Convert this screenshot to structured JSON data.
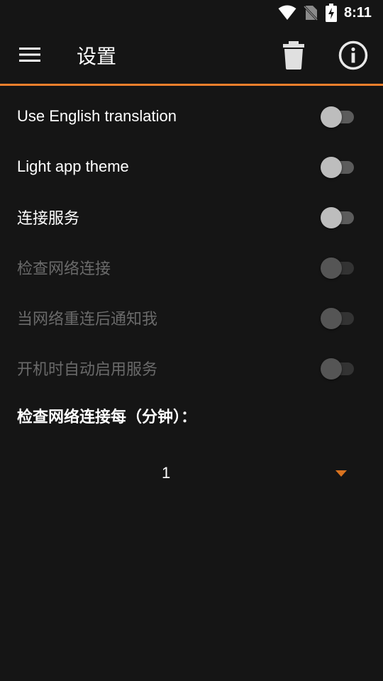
{
  "status_bar": {
    "time": "8:11",
    "icons": [
      "wifi-icon",
      "no-sim-icon",
      "battery-charging-icon"
    ]
  },
  "toolbar": {
    "title": "设置",
    "icons": [
      "menu-icon",
      "trash-icon",
      "info-icon"
    ],
    "accent_color": "#f07f2c"
  },
  "settings": [
    {
      "label": "Use English translation",
      "enabled": true,
      "checked": false
    },
    {
      "label": "Light app theme",
      "enabled": true,
      "checked": false
    },
    {
      "label": "连接服务",
      "enabled": true,
      "checked": false
    },
    {
      "label": "检查网络连接",
      "enabled": false,
      "checked": false
    },
    {
      "label": "当网络重连后通知我",
      "enabled": false,
      "checked": false
    },
    {
      "label": "开机时自动启用服务",
      "enabled": false,
      "checked": false
    }
  ],
  "interval": {
    "label": "检查网络连接每（分钟）：",
    "selected_value": "1"
  }
}
